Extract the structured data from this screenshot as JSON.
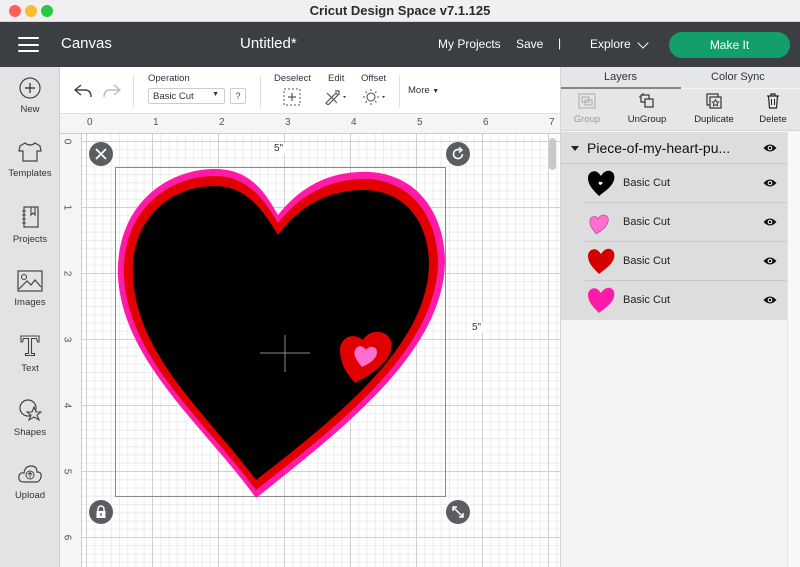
{
  "window": {
    "title": "Cricut Design Space  v7.1.125",
    "traffic_lights": [
      {
        "name": "close",
        "color": "#fe5f57"
      },
      {
        "name": "minimize",
        "color": "#febc2e"
      },
      {
        "name": "maximize",
        "color": "#28c840"
      }
    ]
  },
  "header": {
    "menu_icon": "hamburger-menu-icon",
    "section": "Canvas",
    "doc_title": "Untitled*",
    "my_projects": "My Projects",
    "save": "Save",
    "separator": "|",
    "explore": "Explore",
    "make_it": "Make It",
    "accent": "#139f6b"
  },
  "sidebar": {
    "items": [
      {
        "label": "New",
        "icon": "plus-circle-icon"
      },
      {
        "label": "Templates",
        "icon": "tshirt-icon"
      },
      {
        "label": "Projects",
        "icon": "notebook-icon"
      },
      {
        "label": "Images",
        "icon": "image-icon"
      },
      {
        "label": "Text",
        "icon": "text-t-icon"
      },
      {
        "label": "Shapes",
        "icon": "shapes-icon"
      },
      {
        "label": "Upload",
        "icon": "cloud-upload-icon"
      }
    ]
  },
  "toolbar": {
    "undo_icon": "undo-icon",
    "redo_icon": "redo-icon",
    "operation_label": "Operation",
    "operation_value": "Basic Cut",
    "help": "?",
    "deselect": "Deselect",
    "edit": "Edit",
    "offset": "Offset",
    "more": "More"
  },
  "canvas": {
    "ruler_top": [
      "0",
      "1",
      "2",
      "3",
      "4",
      "5",
      "6",
      "7"
    ],
    "ruler_left": [
      "0",
      "1",
      "2",
      "3",
      "4",
      "5",
      "6"
    ],
    "width_label": "5\"",
    "height_label": "5\"",
    "handles": {
      "delete": "close-icon",
      "rotate": "rotate-icon",
      "lock": "lock-icon",
      "resize": "resize-arrows-icon"
    },
    "heart_colors": {
      "outer": "#ff1aa8",
      "middle": "#e00000",
      "inner": "#000000",
      "small_outer": "#e00000",
      "small_inner": "#ff6fd0"
    }
  },
  "panel": {
    "tabs": [
      "Layers",
      "Color Sync"
    ],
    "active_tab": "Layers",
    "actions": [
      {
        "label": "Group",
        "icon": "group-icon",
        "disabled": true
      },
      {
        "label": "UnGroup",
        "icon": "ungroup-icon",
        "disabled": false
      },
      {
        "label": "Duplicate",
        "icon": "duplicate-icon",
        "disabled": false
      },
      {
        "label": "Delete",
        "icon": "trash-icon",
        "disabled": false
      }
    ],
    "group_name": "Piece-of-my-heart-pu...",
    "layers": [
      {
        "name": "Basic Cut",
        "color": "#000000"
      },
      {
        "name": "Basic Cut",
        "color": "#ff6fd0"
      },
      {
        "name": "Basic Cut",
        "color": "#d40000"
      },
      {
        "name": "Basic Cut",
        "color": "#ff1aa8"
      }
    ]
  }
}
